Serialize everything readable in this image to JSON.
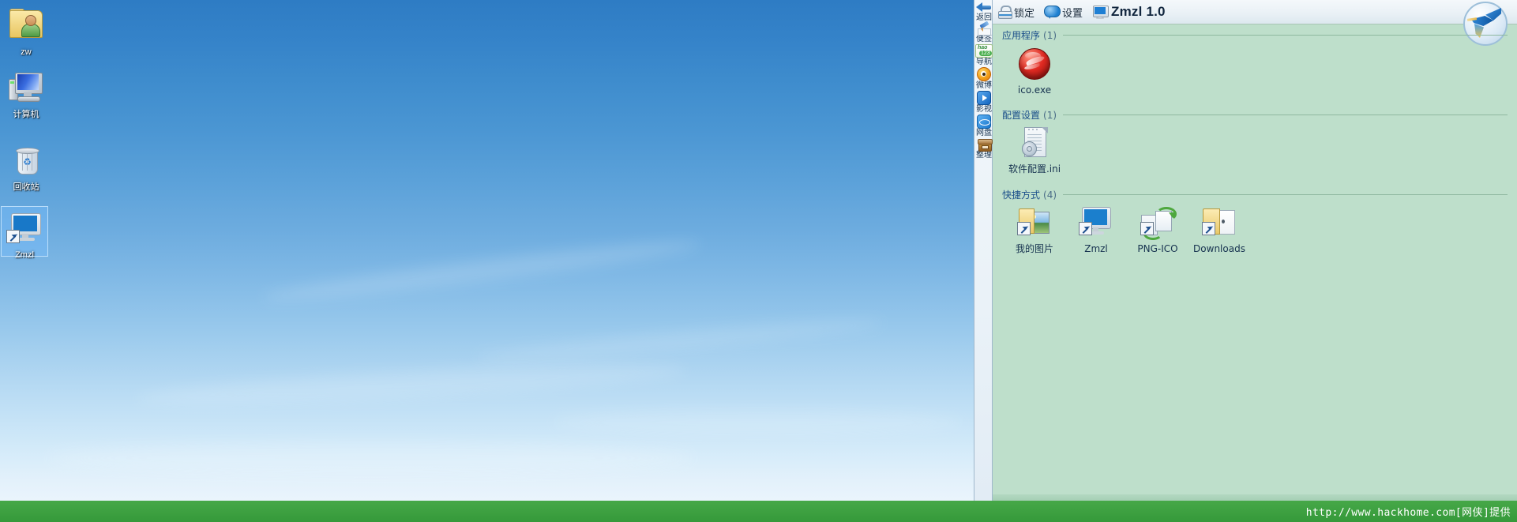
{
  "desktop": {
    "icons": [
      {
        "label": "zw",
        "icon": "user-folder-icon",
        "selected": false
      },
      {
        "label": "计算机",
        "icon": "computer-icon",
        "selected": false
      },
      {
        "label": "回收站",
        "icon": "recycle-bin-icon",
        "selected": false
      },
      {
        "label": "Zmzl",
        "icon": "monitor-shortcut-icon",
        "selected": true
      }
    ]
  },
  "toolstrip": {
    "items": [
      {
        "label": "返回",
        "icon": "back-arrow-icon"
      },
      {
        "label": "便签",
        "icon": "sticky-note-pen-icon"
      },
      {
        "label": "导航",
        "icon": "hao123-navigation-icon"
      },
      {
        "label": "微博",
        "icon": "weibo-icon"
      },
      {
        "label": "影视",
        "icon": "video-play-icon"
      },
      {
        "label": "网盘",
        "icon": "cloud-disk-icon"
      },
      {
        "label": "整理",
        "icon": "organize-box-icon"
      }
    ]
  },
  "panel": {
    "header": {
      "lock_label": "锁定",
      "settings_label": "设置",
      "app_title": "Zmzl 1.0",
      "lock_icon": "lock-icon",
      "settings_icon": "chat-bubble-icon",
      "title_icon": "monitor-icon",
      "logo_icon": "hummingbird-logo-icon"
    },
    "sections": [
      {
        "title": "应用程序",
        "count": "(1)",
        "items": [
          {
            "label": "ico.exe",
            "icon": "red-ball-app-icon",
            "shortcut": false
          }
        ]
      },
      {
        "title": "配置设置",
        "count": "(1)",
        "items": [
          {
            "label": "软件配置.ini",
            "icon": "ini-config-file-icon",
            "shortcut": false
          }
        ]
      },
      {
        "title": "快捷方式",
        "count": "(4)",
        "items": [
          {
            "label": "我的图片",
            "icon": "pictures-folder-icon",
            "shortcut": true
          },
          {
            "label": "Zmzl",
            "icon": "monitor-shortcut-icon",
            "shortcut": true
          },
          {
            "label": "PNG-ICO",
            "icon": "png-ico-convert-icon",
            "shortcut": true
          },
          {
            "label": "Downloads",
            "icon": "downloads-folder-icon",
            "shortcut": true
          }
        ]
      }
    ]
  },
  "statusbar": {
    "url": "http://www.hackhome.com[网侠]提供"
  },
  "colors": {
    "panel_background": "#bedfcb",
    "status_bar_green": "#3e9f42",
    "section_title": "#1b4f8a",
    "desktop_blue": "#3a86cc"
  }
}
